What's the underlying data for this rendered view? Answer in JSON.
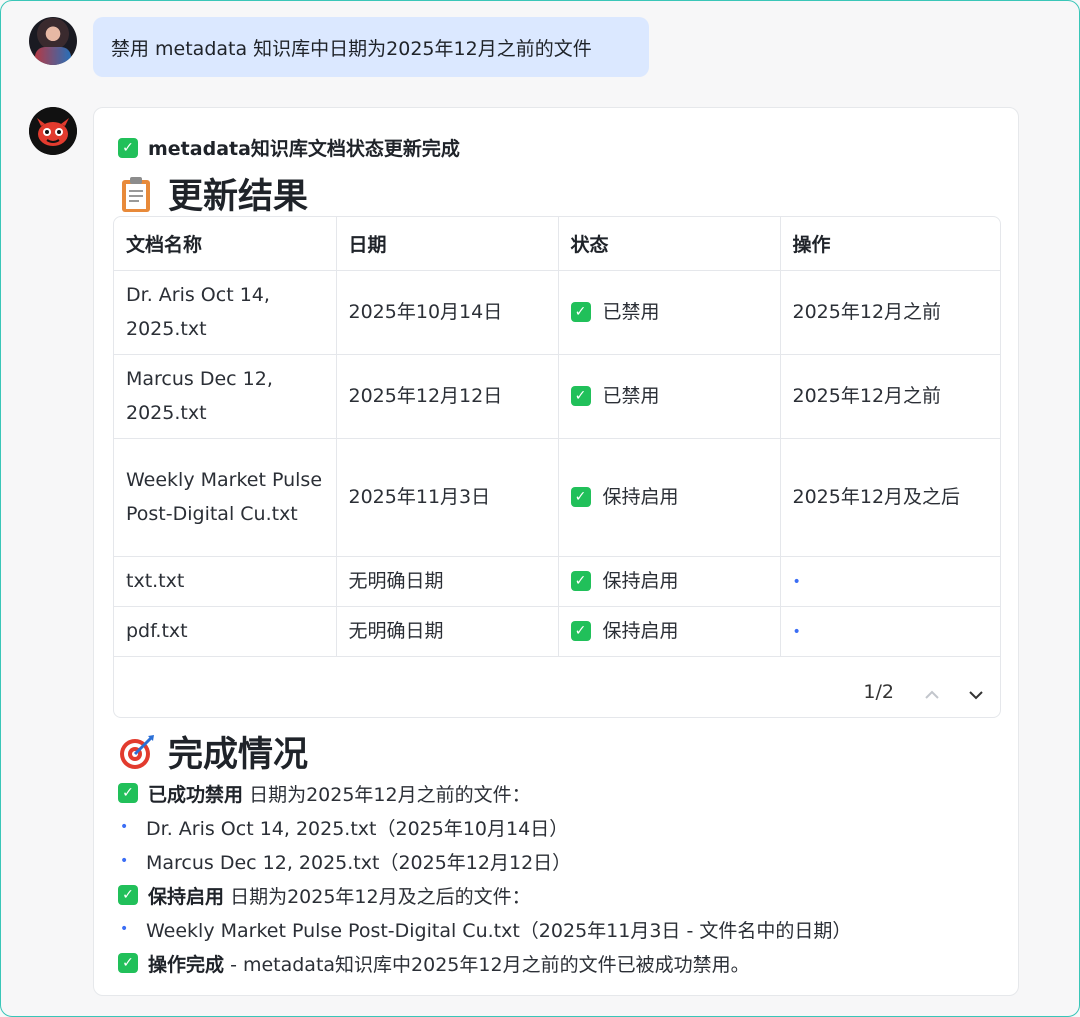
{
  "user_message": "禁用 metadata 知识库中日期为2025年12月之前的文件",
  "response": {
    "status_title": "metadata知识库文档状态更新完成",
    "result_heading": "更新结果",
    "table": {
      "headers": [
        "文档名称",
        "日期",
        "状态",
        "操作"
      ],
      "rows": [
        {
          "name": "Dr. Aris Oct 14, 2025.txt",
          "date": "2025年10月14日",
          "status": "已禁用",
          "action": "2025年12月之前"
        },
        {
          "name": "Marcus Dec 12, 2025.txt",
          "date": "2025年12月12日",
          "status": "已禁用",
          "action": "2025年12月之前"
        },
        {
          "name": "Weekly Market Pulse Post-Digital Cu.txt",
          "date": "2025年11月3日",
          "status": "保持启用",
          "action": "2025年12月及之后"
        },
        {
          "name": "txt.txt",
          "date": "无明确日期",
          "status": "保持启用",
          "action": "•"
        },
        {
          "name": "pdf.txt",
          "date": "无明确日期",
          "status": "保持启用",
          "action": "•"
        }
      ],
      "pager": "1/2"
    },
    "done_heading": "完成情况",
    "summary": {
      "disabled_label": "已成功禁用",
      "disabled_text": "日期为2025年12月之前的文件：",
      "disabled_items": [
        "Dr. Aris Oct 14, 2025.txt（2025年10月14日）",
        "Marcus Dec 12, 2025.txt（2025年12月12日）"
      ],
      "kept_label": "保持启用",
      "kept_text": "日期为2025年12月及之后的文件：",
      "kept_items": [
        "Weekly Market Pulse Post-Digital Cu.txt（2025年11月3日 - 文件名中的日期）"
      ],
      "complete_label": "操作完成",
      "complete_text": "- metadata知识库中2025年12月之前的文件已被成功禁用。"
    }
  },
  "colors": {
    "accent_check": "#21c05a",
    "user_bubble": "#dbe8ff",
    "bullet": "#3b6ef5"
  }
}
